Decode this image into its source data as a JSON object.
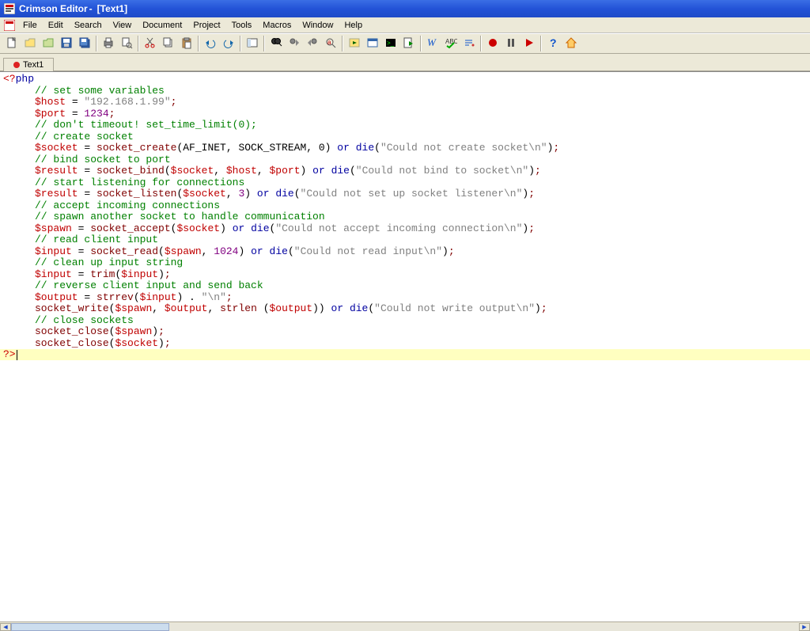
{
  "titlebar": {
    "app_name": "Crimson Editor",
    "doc_name": "[Text1]"
  },
  "menubar": {
    "items": [
      "File",
      "Edit",
      "Search",
      "View",
      "Document",
      "Project",
      "Tools",
      "Macros",
      "Window",
      "Help"
    ]
  },
  "toolbar": {
    "buttons": [
      "new-file",
      "open-file",
      "open-folder",
      "save",
      "save-all",
      "sep",
      "print",
      "print-preview",
      "sep",
      "cut",
      "copy",
      "paste",
      "sep",
      "undo",
      "redo",
      "sep",
      "toggle-panel",
      "sep",
      "find",
      "find-next",
      "find-prev",
      "replace",
      "sep",
      "run-external",
      "browser",
      "command",
      "run-script",
      "sep",
      "word-wrap",
      "spell-check",
      "show-whitespace",
      "sep",
      "record-macro",
      "pause-macro",
      "play-macro",
      "sep",
      "help",
      "home"
    ]
  },
  "tabs": [
    {
      "label": "Text1",
      "modified": true
    }
  ],
  "code": {
    "open_tag": "<?php",
    "close_tag": "?>",
    "lines": [
      {
        "type": "cm",
        "text": "// set some variables"
      },
      {
        "type": "assign_str",
        "var": "$host",
        "val": "\"192.168.1.99\""
      },
      {
        "type": "assign_num",
        "var": "$port",
        "val": "1234"
      },
      {
        "type": "cm",
        "text": "// don't timeout! set_time_limit(0);"
      },
      {
        "type": "cm",
        "text": "// create socket"
      },
      {
        "type": "call_die",
        "var": "$socket",
        "fn": "socket_create",
        "args": "(AF_INET, SOCK_STREAM, 0)",
        "die": "\"Could not create socket\\n\""
      },
      {
        "type": "cm",
        "text": "// bind socket to port"
      },
      {
        "type": "call_die_vars",
        "var": "$result",
        "fn": "socket_bind",
        "args_vars": [
          "$socket",
          "$host",
          "$port"
        ],
        "die": "\"Could not bind to socket\\n\""
      },
      {
        "type": "cm",
        "text": "// start listening for connections"
      },
      {
        "type": "call_die_mixed",
        "var": "$result",
        "fn": "socket_listen",
        "arg_var": "$socket",
        "arg_lit": "3",
        "die": "\"Could not set up socket listener\\n\""
      },
      {
        "type": "cm",
        "text": "// accept incoming connections"
      },
      {
        "type": "cm",
        "text": "// spawn another socket to handle communication"
      },
      {
        "type": "call_die_var1",
        "var": "$spawn",
        "fn": "socket_accept",
        "arg_var": "$socket",
        "die": "\"Could not accept incoming connection\\n\""
      },
      {
        "type": "cm",
        "text": "// read client input"
      },
      {
        "type": "call_die_mixed",
        "var": "$input",
        "fn": "socket_read",
        "arg_var": "$spawn",
        "arg_lit": "1024",
        "die": "\"Could not read input\\n\""
      },
      {
        "type": "cm",
        "text": "// clean up input string"
      },
      {
        "type": "trim",
        "var": "$input",
        "fn": "trim",
        "arg_var": "$input"
      },
      {
        "type": "cm",
        "text": "// reverse client input and send back"
      },
      {
        "type": "strrev",
        "var": "$output",
        "fn": "strrev",
        "arg_var": "$input",
        "concat": "\"\\n\""
      },
      {
        "type": "write",
        "fn": "socket_write",
        "v1": "$spawn",
        "v2": "$output",
        "fn2": "strlen",
        "v3": "$output",
        "die": "\"Could not write output\\n\""
      },
      {
        "type": "cm",
        "text": "// close sockets"
      },
      {
        "type": "close",
        "fn": "socket_close",
        "arg_var": "$spawn"
      },
      {
        "type": "close",
        "fn": "socket_close",
        "arg_var": "$socket"
      }
    ]
  }
}
